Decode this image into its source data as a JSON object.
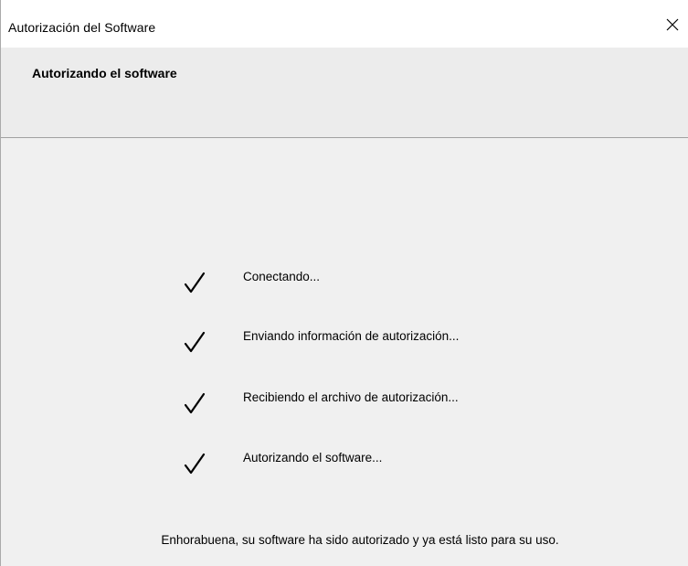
{
  "window": {
    "title": "Autorización del Software",
    "close_icon": "close-icon"
  },
  "header": {
    "title": "Autorizando el software"
  },
  "steps": [
    {
      "label": "Conectando...",
      "status": "done",
      "icon": "checkmark-icon"
    },
    {
      "label": "Enviando información de autorización...",
      "status": "done",
      "icon": "checkmark-icon"
    },
    {
      "label": "Recibiendo el archivo de autorización...",
      "status": "done",
      "icon": "checkmark-icon"
    },
    {
      "label": "Autorizando el software...",
      "status": "done",
      "icon": "checkmark-icon"
    }
  ],
  "message": "Enhorabuena, su software ha sido autorizado y ya está listo para su uso."
}
